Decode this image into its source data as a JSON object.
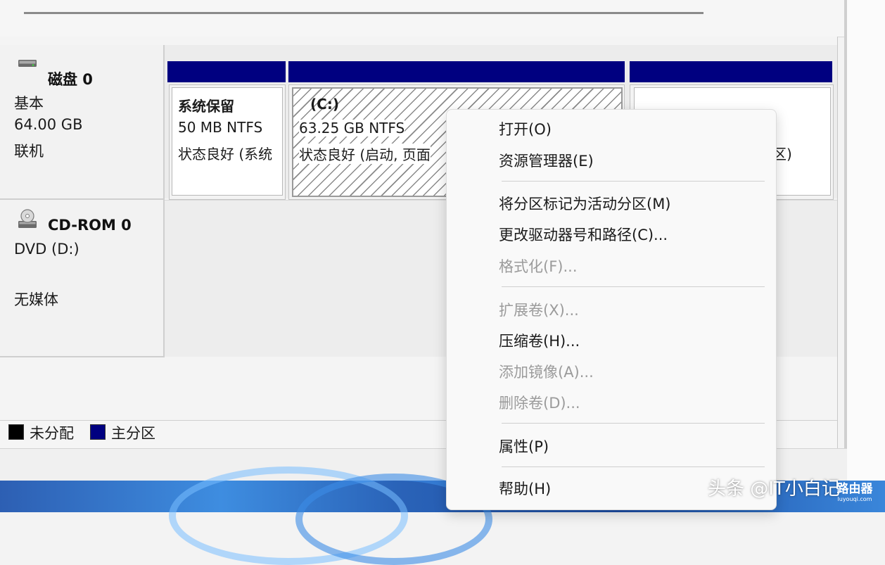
{
  "disks": [
    {
      "name": "磁盘 0",
      "type": "基本",
      "size": "64.00 GB",
      "status": "联机",
      "partitions": [
        {
          "title": "系统保留",
          "size": "50 MB NTFS",
          "status": "状态良好 (系统"
        },
        {
          "title": "(C:)",
          "size": "63.25 GB NTFS",
          "status": "状态良好 (启动, 页面"
        },
        {
          "title": "",
          "size": "",
          "status": "区)"
        }
      ]
    },
    {
      "name": "CD-ROM 0",
      "type": "DVD (D:)",
      "status": "无媒体"
    }
  ],
  "legend": [
    {
      "label": "未分配",
      "color": "#000000"
    },
    {
      "label": "主分区",
      "color": "#000080"
    }
  ],
  "context_menu": {
    "items": [
      {
        "label": "打开(O)",
        "enabled": true
      },
      {
        "label": "资源管理器(E)",
        "enabled": true
      },
      {
        "label": "将分区标记为活动分区(M)",
        "enabled": true
      },
      {
        "label": "更改驱动器号和路径(C)...",
        "enabled": true
      },
      {
        "label": "格式化(F)...",
        "enabled": false
      },
      {
        "label": "扩展卷(X)...",
        "enabled": false
      },
      {
        "label": "压缩卷(H)...",
        "enabled": true
      },
      {
        "label": "添加镜像(A)...",
        "enabled": false
      },
      {
        "label": "删除卷(D)...",
        "enabled": false
      },
      {
        "label": "属性(P)",
        "enabled": true
      },
      {
        "label": "帮助(H)",
        "enabled": true
      }
    ]
  },
  "watermark": {
    "text": "头条 @IT小白记",
    "logo_text": "路由器",
    "logo_sub": "luyouqi.com"
  },
  "colors": {
    "primary_partition": "#000080",
    "unallocated": "#000000"
  },
  "icons": [
    "hard-disk-icon",
    "cd-rom-icon"
  ]
}
